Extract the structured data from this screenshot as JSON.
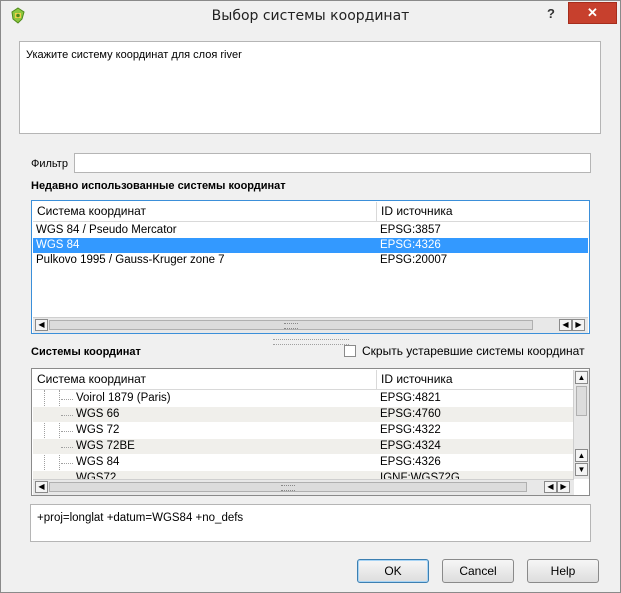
{
  "window": {
    "title": "Выбор системы координат",
    "help_glyph": "?",
    "close_glyph": "✕"
  },
  "description": "Укажите систему координат для слоя river",
  "filter": {
    "label": "Фильтр",
    "value": ""
  },
  "recent": {
    "label": "Недавно использованные системы координат",
    "columns": [
      "Система координат",
      "ID источника"
    ],
    "rows": [
      {
        "name": "WGS 84 / Pseudo Mercator",
        "id": "EPSG:3857"
      },
      {
        "name": "WGS 84",
        "id": "EPSG:4326"
      },
      {
        "name": "Pulkovo 1995 / Gauss-Kruger zone 7",
        "id": "EPSG:20007"
      }
    ],
    "selected_index": 1
  },
  "all": {
    "label": "Системы координат",
    "hide_deprecated_label": "Скрыть устаревшие системы координат",
    "hide_deprecated_checked": false,
    "columns": [
      "Система координат",
      "ID источника"
    ],
    "rows": [
      {
        "name": "Voirol 1879 (Paris)",
        "id": "EPSG:4821"
      },
      {
        "name": "WGS 66",
        "id": "EPSG:4760"
      },
      {
        "name": "WGS 72",
        "id": "EPSG:4322"
      },
      {
        "name": "WGS 72BE",
        "id": "EPSG:4324"
      },
      {
        "name": "WGS 84",
        "id": "EPSG:4326"
      },
      {
        "name": "WGS72",
        "id": "IGNF:WGS72G"
      }
    ]
  },
  "proj_string": "+proj=longlat +datum=WGS84 +no_defs",
  "buttons": {
    "ok": "OK",
    "cancel": "Cancel",
    "help": "Help"
  },
  "colors": {
    "selection": "#3399ff",
    "close_button": "#c7402d"
  }
}
